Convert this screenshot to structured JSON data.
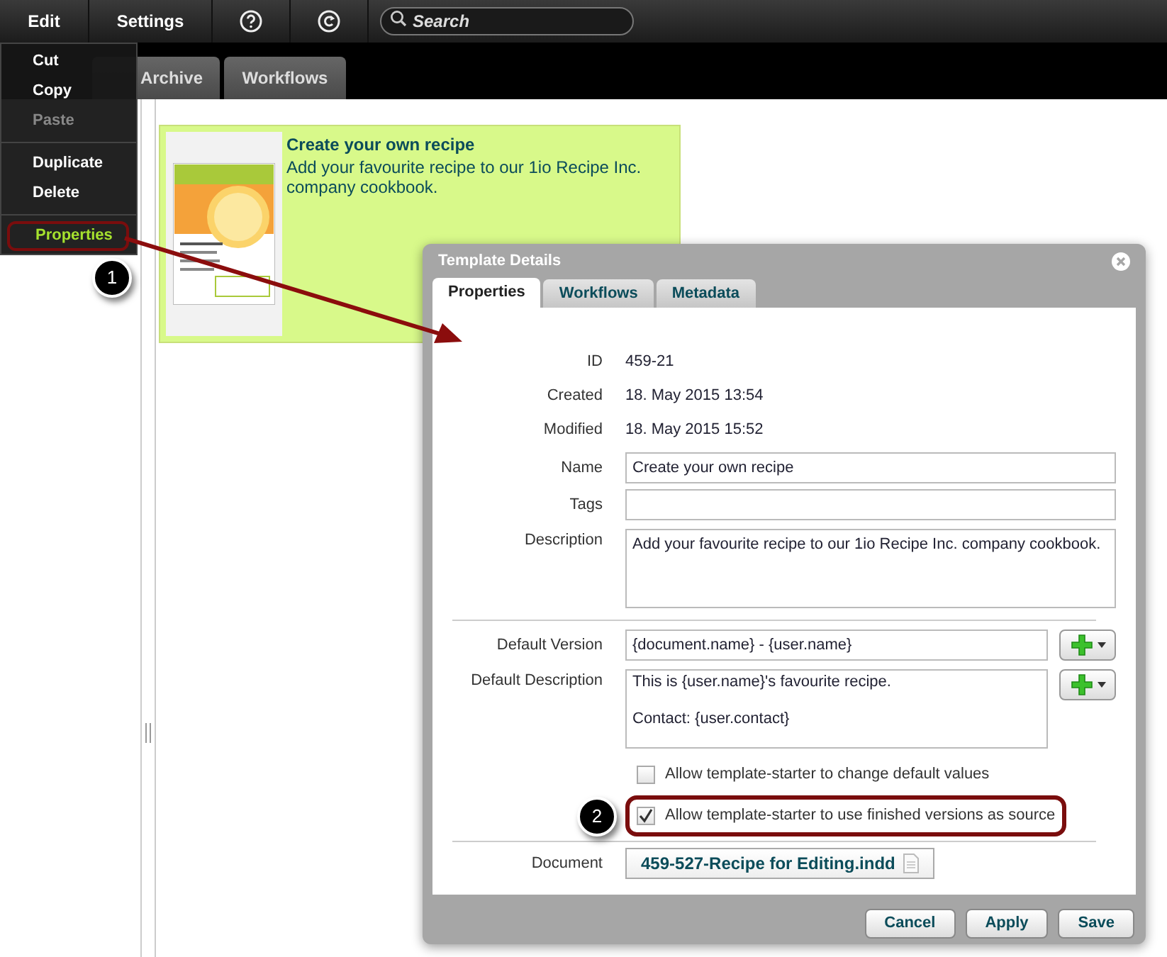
{
  "toolbar": {
    "menu_buttons": [
      "Edit",
      "Settings"
    ],
    "search": {
      "placeholder": "Search"
    }
  },
  "tabs": [
    {
      "label": "Archive",
      "selected": false
    },
    {
      "label": "Workflows",
      "selected": false
    }
  ],
  "edit_menu": {
    "groups": [
      [
        {
          "label": "Cut",
          "disabled": false,
          "selected": false
        },
        {
          "label": "Copy",
          "disabled": false,
          "selected": false
        },
        {
          "label": "Paste",
          "disabled": true,
          "selected": false
        }
      ],
      [
        {
          "label": "Duplicate",
          "disabled": false,
          "selected": false
        },
        {
          "label": "Delete",
          "disabled": false,
          "selected": false
        }
      ],
      [
        {
          "label": "Properties",
          "disabled": false,
          "selected": true,
          "callout": "1"
        }
      ]
    ]
  },
  "template_card": {
    "title": "Create your own recipe",
    "description": "Add your favourite recipe to our 1io Recipe Inc. company cookbook."
  },
  "dialog": {
    "title": "Template Details",
    "tabs": [
      {
        "label": "Properties",
        "selected": true
      },
      {
        "label": "Workflows",
        "selected": false
      },
      {
        "label": "Metadata",
        "selected": false
      }
    ],
    "fields": [
      {
        "kind": "text",
        "label": "ID",
        "value": "459-21"
      },
      {
        "kind": "text",
        "label": "Created",
        "value": "18. May 2015 13:54"
      },
      {
        "kind": "text",
        "label": "Modified",
        "value": "18. May 2015 15:52"
      },
      {
        "kind": "input",
        "label": "Name",
        "value": "Create your own recipe"
      },
      {
        "kind": "input",
        "label": "Tags"
      },
      {
        "kind": "textarea",
        "label": "Description",
        "value": "Add your favourite recipe to our 1io Recipe Inc. company cookbook."
      },
      {
        "kind": "divider"
      },
      {
        "kind": "input_insert",
        "label": "Default Version",
        "value": "{document.name} - {user.name}"
      },
      {
        "kind": "textarea_insert",
        "label": "Default Description",
        "value": "This is {user.name}'s favourite recipe.\n\nContact: {user.contact}"
      }
    ],
    "checkboxes": [
      {
        "label": "Allow template-starter to change default values",
        "checked": false,
        "highlighted": false
      },
      {
        "label": "Allow template-starter to use finished versions as source",
        "checked": true,
        "highlighted": true,
        "callout": "2"
      }
    ],
    "document": {
      "label": "Document",
      "file": "459-527-Recipe for Editing.indd"
    },
    "buttons": [
      "Cancel",
      "Apply",
      "Save"
    ]
  }
}
